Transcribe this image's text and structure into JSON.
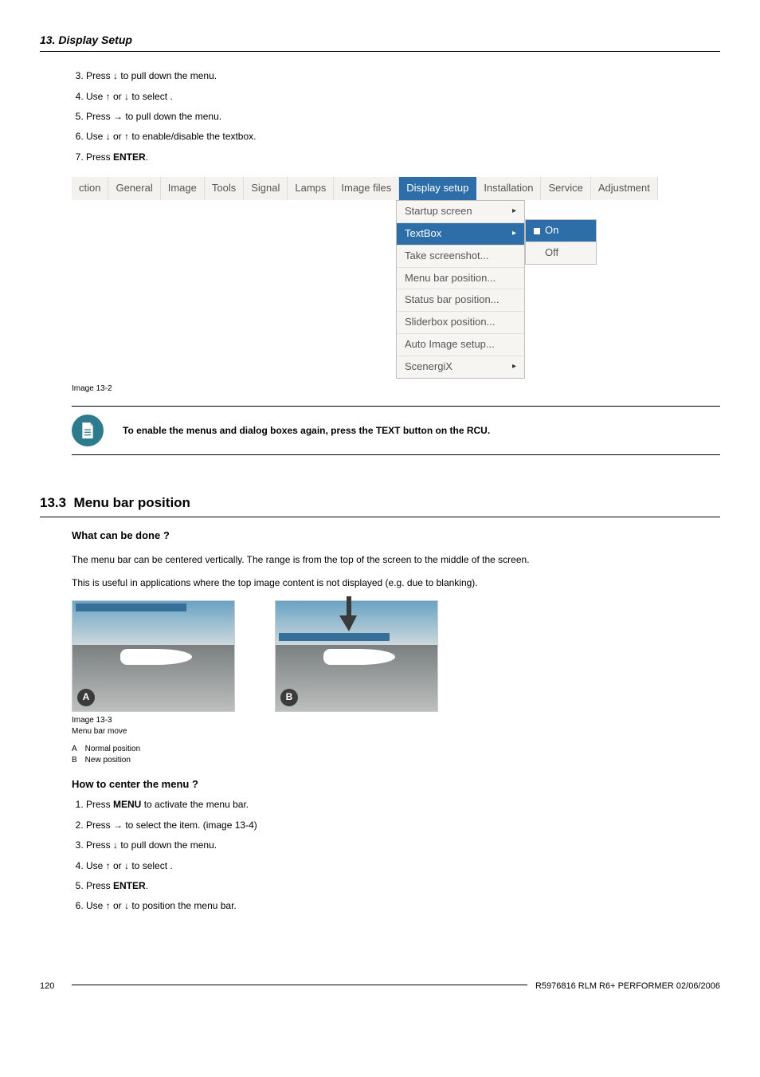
{
  "header": {
    "title": "13. Display Setup"
  },
  "steps_top": {
    "start": 3,
    "items": [
      {
        "n": "3.",
        "text": "Press ↓ to pull down the                              menu."
      },
      {
        "n": "4.",
        "text": "Use ↑ or ↓ to select             ."
      },
      {
        "n": "5.",
        "text": "Press → to pull down the menu."
      },
      {
        "n": "6.",
        "text": "Use ↓ or ↑ to enable/disable the textbox."
      },
      {
        "n": "7.",
        "text_prefix": "Press ",
        "bold": "ENTER",
        "text_suffix": "."
      }
    ]
  },
  "menubar": {
    "tabs": [
      "ction",
      "General",
      "Image",
      "Tools",
      "Signal",
      "Lamps",
      "Image files",
      "Display setup",
      "Installation",
      "Service",
      "Adjustment"
    ],
    "selected": "Display setup"
  },
  "dropdown": {
    "items": [
      {
        "label": "Startup screen",
        "arrow": true
      },
      {
        "label": "TextBox",
        "arrow": true,
        "selected": true
      },
      {
        "label": "Take screenshot..."
      },
      {
        "label": "Menu bar position..."
      },
      {
        "label": "Status bar position..."
      },
      {
        "label": "Sliderbox position..."
      },
      {
        "label": "Auto Image setup..."
      },
      {
        "label": "ScenergiX",
        "arrow": true
      }
    ]
  },
  "submenu": {
    "items": [
      {
        "label": "On",
        "marker": true,
        "selected": true
      },
      {
        "label": "Off"
      }
    ]
  },
  "caption1": "Image 13-2",
  "note": {
    "text": "To enable the menus and dialog boxes again, press the TEXT button on the RCU."
  },
  "section": {
    "number": "13.3",
    "title": "Menu bar position",
    "what_head": "What can be done ?",
    "what_p1": "The menu bar can be centered vertically. The range is from the top of the screen to the middle of the screen.",
    "what_p2": "This is useful in applications where the top image content is not displayed (e.g. due to blanking).",
    "illus_caption_1": "Image 13-3",
    "illus_caption_2": "Menu bar move",
    "legend": [
      {
        "key": "A",
        "val": "Normal position"
      },
      {
        "key": "B",
        "val": "New position"
      }
    ],
    "how_head": "How to center the menu ?",
    "steps": [
      {
        "n": "1.",
        "text_prefix": "Press ",
        "bold": "MENU",
        "text_suffix": " to activate the menu bar."
      },
      {
        "n": "2.",
        "text": "Press → to select the                            item. (image 13-4)"
      },
      {
        "n": "3.",
        "text": "Press ↓ to pull down the                              menu."
      },
      {
        "n": "4.",
        "text": "Use ↑ or ↓ to select                                       ."
      },
      {
        "n": "5.",
        "text_prefix": "Press ",
        "bold": "ENTER",
        "text_suffix": "."
      },
      {
        "n": "6.",
        "text": "Use ↑ or ↓ to position the menu bar."
      }
    ]
  },
  "footer": {
    "page": "120",
    "docid": "R5976816 RLM R6+ PERFORMER 02/06/2006"
  }
}
